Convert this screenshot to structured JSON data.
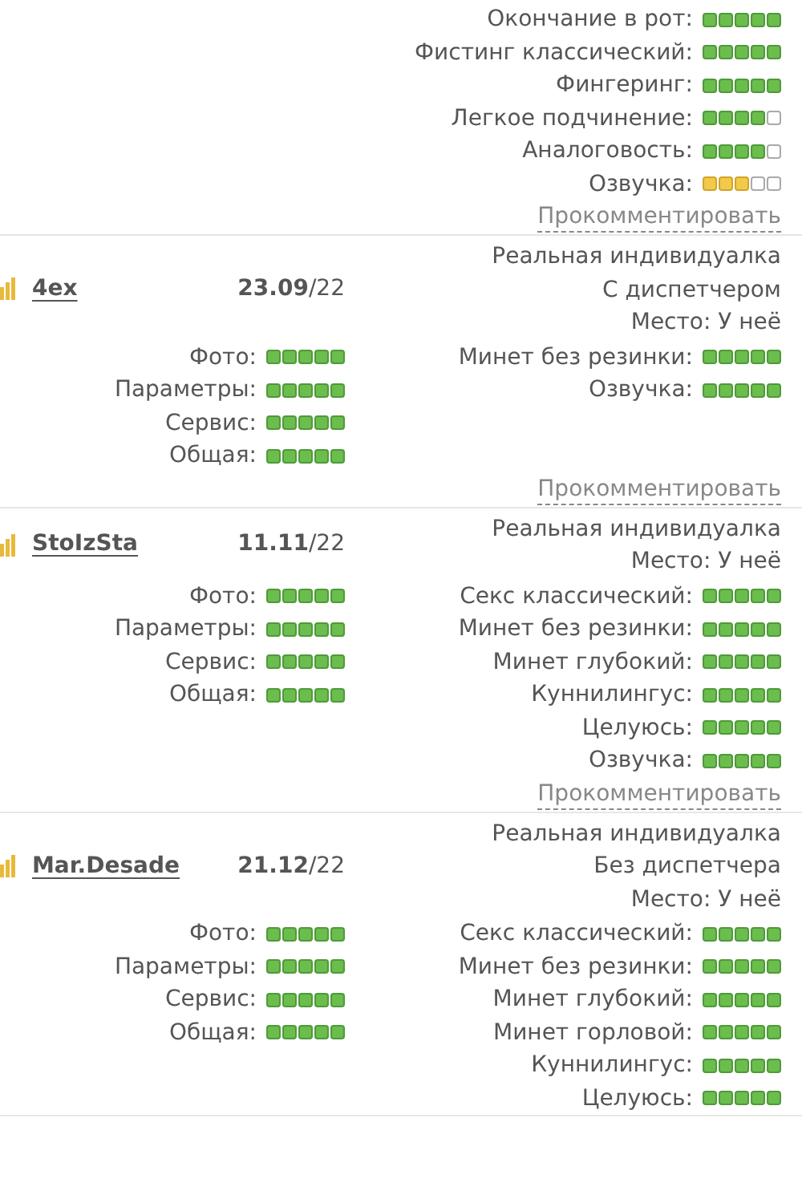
{
  "reviews": [
    {
      "right_ratings": [
        {
          "label": "Окончание в рот:",
          "stars": 5
        },
        {
          "label": "Фистинг классический:",
          "stars": 5
        },
        {
          "label": "Фингеринг:",
          "stars": 5
        },
        {
          "label": "Легкое подчинение:",
          "stars": 4
        },
        {
          "label": "Аналоговость:",
          "stars": 4
        },
        {
          "label": "Озвучка:",
          "stars": 3
        }
      ],
      "comment_link": "Прокомментировать"
    },
    {
      "user": "4ex",
      "date": "**23.09**/22",
      "info": [
        "Реальная индивидуалка",
        "С диспетчером",
        "Место: У неё"
      ],
      "left_ratings": [
        {
          "label": "Фото:",
          "stars": 5
        },
        {
          "label": "Параметры:",
          "stars": 5
        },
        {
          "label": "Сервис:",
          "stars": 5
        },
        {
          "label": "Общая:",
          "stars": 5
        }
      ],
      "right_ratings": [
        {
          "label": "Минет без резинки:",
          "stars": 5
        },
        {
          "label": "Озвучка:",
          "stars": 5
        }
      ],
      "comment_link": "Прокомментировать"
    },
    {
      "user": "StoIzSta",
      "date": "**11.11**/22",
      "info": [
        "Реальная индивидуалка",
        "Место: У неё"
      ],
      "left_ratings": [
        {
          "label": "Фото:",
          "stars": 5
        },
        {
          "label": "Параметры:",
          "stars": 5
        },
        {
          "label": "Сервис:",
          "stars": 5
        },
        {
          "label": "Общая:",
          "stars": 5
        }
      ],
      "right_ratings": [
        {
          "label": "Секс классический:",
          "stars": 5
        },
        {
          "label": "Минет без резинки:",
          "stars": 5
        },
        {
          "label": "Минет глубокий:",
          "stars": 5
        },
        {
          "label": "Куннилингус:",
          "stars": 5
        },
        {
          "label": "Целуюсь:",
          "stars": 5
        },
        {
          "label": "Озвучка:",
          "stars": 5
        }
      ],
      "comment_link": "Прокомментировать"
    },
    {
      "user": "Mar.Desade",
      "date": "**21.12**/22",
      "info": [
        "Реальная индивидуалка",
        "Без диспетчера",
        "Место: У неё"
      ],
      "left_ratings": [
        {
          "label": "Фото:",
          "stars": 5
        },
        {
          "label": "Параметры:",
          "stars": 5
        },
        {
          "label": "Сервис:",
          "stars": 5
        },
        {
          "label": "Общая:",
          "stars": 5
        }
      ],
      "right_ratings": [
        {
          "label": "Секс классический:",
          "stars": 5
        },
        {
          "label": "Минет без резинки:",
          "stars": 5
        },
        {
          "label": "Минет глубокий:",
          "stars": 5
        },
        {
          "label": "Минет горловой:",
          "stars": 5
        },
        {
          "label": "Куннилингус:",
          "stars": 5
        },
        {
          "label": "Целуюсь:",
          "stars": 5
        }
      ]
    }
  ]
}
